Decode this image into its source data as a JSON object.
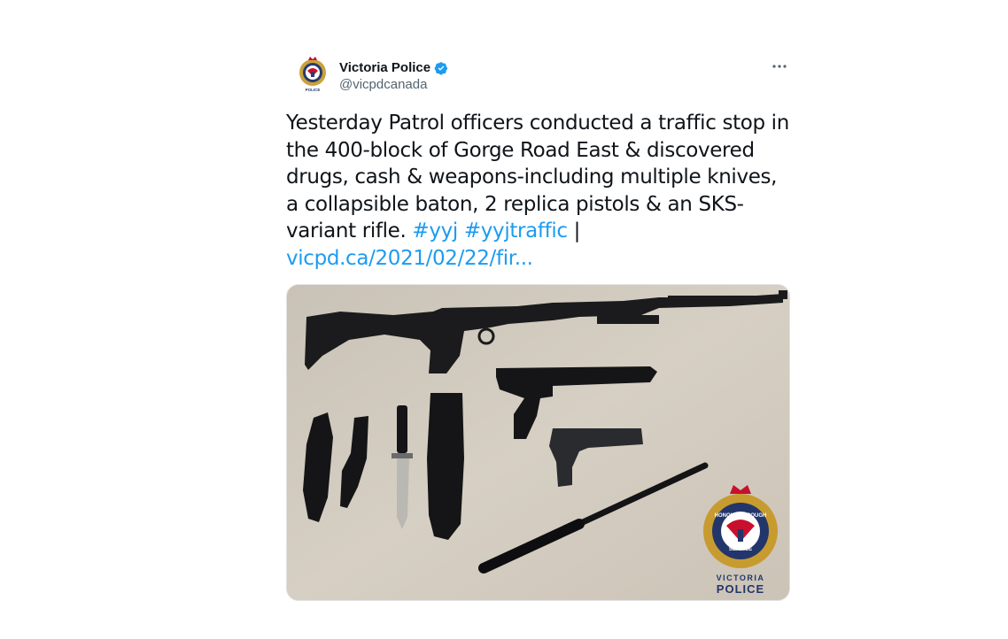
{
  "tweet": {
    "author": {
      "display_name": "Victoria Police",
      "handle": "@vicpdcanada",
      "verified": true,
      "avatar_icon": "vicpd-crest-icon"
    },
    "more_icon": "more-horizontal-icon",
    "text_parts": {
      "body": "Yesterday Patrol officers conducted a traffic stop in the 400-block of Gorge Road East & discovered drugs, cash & weapons-including multiple knives, a collapsible baton, 2 replica pistols & an SKS-variant rifle. ",
      "hashtag1": "#yyj",
      "hashtag2": "#yyjtraffic",
      "separator": " | ",
      "url": "vicpd.ca/2021/02/22/fir..."
    },
    "media": {
      "type": "photo",
      "watermark": {
        "motto_top": "HONOUR THROUGH",
        "motto_bottom": "SERVICE",
        "line1": "VICTORIA",
        "line2": "POLICE"
      }
    }
  },
  "colors": {
    "link": "#1d9bf0",
    "verified": "#1d9bf0",
    "secondary_text": "#536471"
  }
}
